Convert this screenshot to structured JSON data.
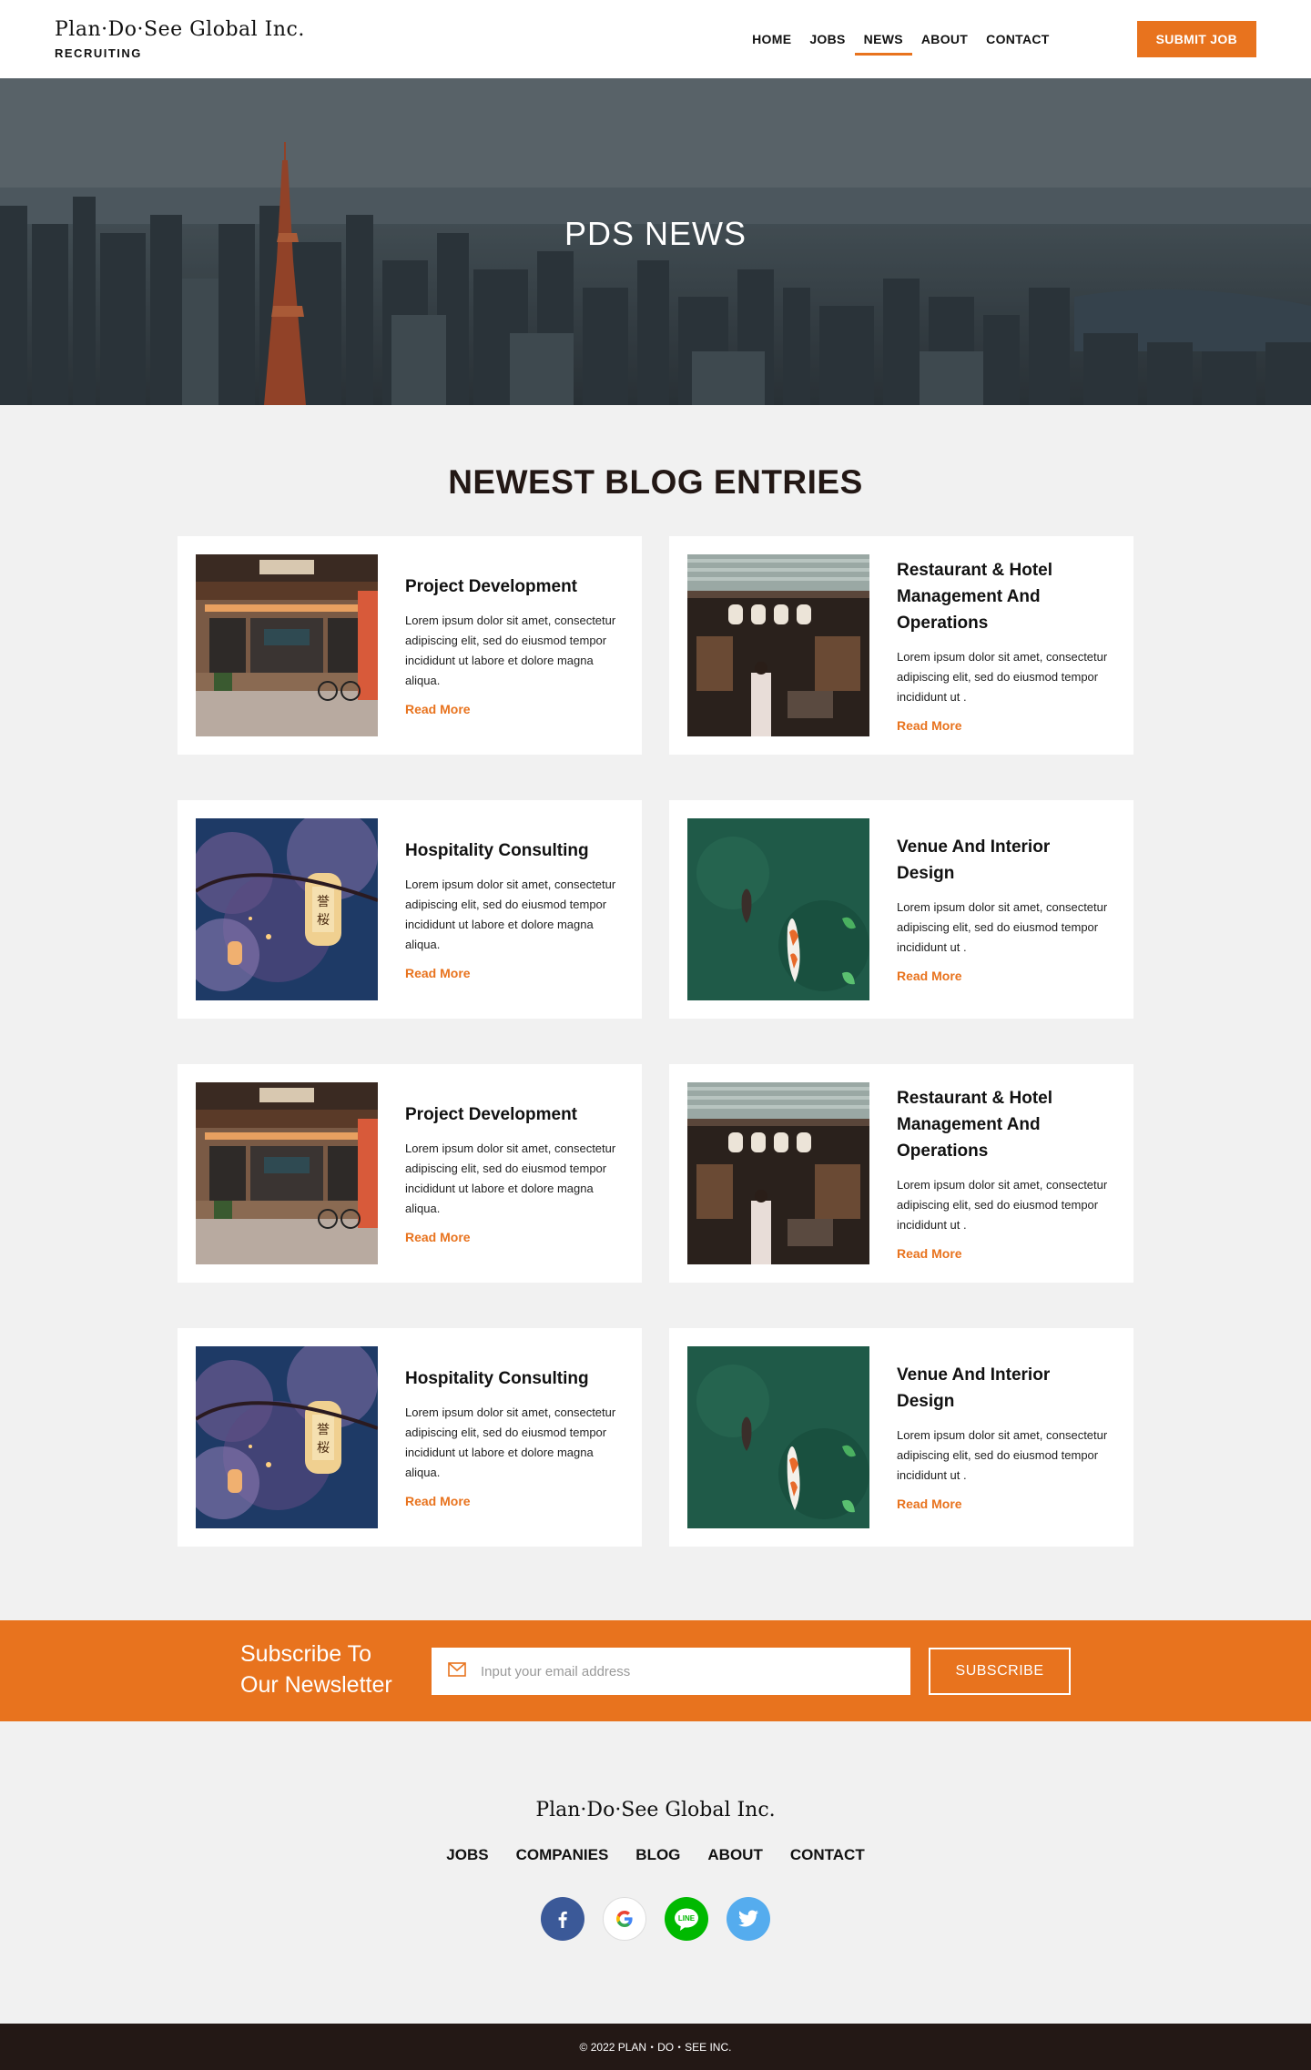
{
  "header": {
    "brand_name": "Plan·Do·See Global Inc.",
    "brand_sub": "RECRUITING",
    "nav": [
      "HOME",
      "JOBS",
      "NEWS",
      "ABOUT",
      "CONTACT"
    ],
    "active_nav": "NEWS",
    "submit_label": "SUBMIT JOB"
  },
  "hero": {
    "title": "PDS NEWS"
  },
  "blog": {
    "heading": "NEWEST BLOG ENTRIES",
    "read_more": "Read More",
    "cards": [
      {
        "title": "Project Development",
        "text": "Lorem ipsum dolor sit amet, consectetur adipiscing elit, sed do eiusmod tempor incididunt ut labore et dolore magna aliqua.",
        "image": "shopfront"
      },
      {
        "title": "Restaurant & Hotel Management And Operations",
        "text": "Lorem ipsum dolor sit amet, consectetur adipiscing elit, sed do eiusmod tempor incididunt ut .",
        "image": "shrine-stall"
      },
      {
        "title": "Hospitality Consulting",
        "text": "Lorem ipsum dolor sit amet, consectetur adipiscing elit, sed do eiusmod tempor incididunt ut labore et dolore magna aliqua.",
        "image": "lantern-blossom"
      },
      {
        "title": "Venue And Interior Design",
        "text": "Lorem ipsum dolor sit amet, consectetur adipiscing elit, sed do eiusmod tempor incididunt ut .",
        "image": "koi-pond"
      },
      {
        "title": "Project Development",
        "text": "Lorem ipsum dolor sit amet, consectetur adipiscing elit, sed do eiusmod tempor incididunt ut labore et dolore magna aliqua.",
        "image": "shopfront"
      },
      {
        "title": "Restaurant & Hotel Management And Operations",
        "text": "Lorem ipsum dolor sit amet, consectetur adipiscing elit, sed do eiusmod tempor incididunt ut .",
        "image": "shrine-stall"
      },
      {
        "title": "Hospitality Consulting",
        "text": "Lorem ipsum dolor sit amet, consectetur adipiscing elit, sed do eiusmod tempor incididunt ut labore et dolore magna aliqua.",
        "image": "lantern-blossom"
      },
      {
        "title": "Venue And Interior Design",
        "text": "Lorem ipsum dolor sit amet, consectetur adipiscing elit, sed do eiusmod tempor incididunt ut .",
        "image": "koi-pond"
      }
    ]
  },
  "newsletter": {
    "title_line1": "Subscribe To",
    "title_line2": "Our Newsletter",
    "placeholder": "Input your email address",
    "button": "SUBSCRIBE",
    "icon": "mail-icon"
  },
  "footer": {
    "brand": "Plan·Do·See Global Inc.",
    "links": [
      "JOBS",
      "COMPANIES",
      "BLOG",
      "ABOUT",
      "CONTACT"
    ],
    "socials": [
      {
        "name": "facebook-icon",
        "color": "#3b5998"
      },
      {
        "name": "google-icon",
        "color": "#ffffff"
      },
      {
        "name": "line-icon",
        "color": "#00b900"
      },
      {
        "name": "twitter-icon",
        "color": "#55acee"
      }
    ],
    "copyright": "© 2022 PLAN・DO・SEE INC."
  },
  "colors": {
    "accent": "#e8731e",
    "dark": "#231815",
    "background": "#f1f1f1"
  }
}
